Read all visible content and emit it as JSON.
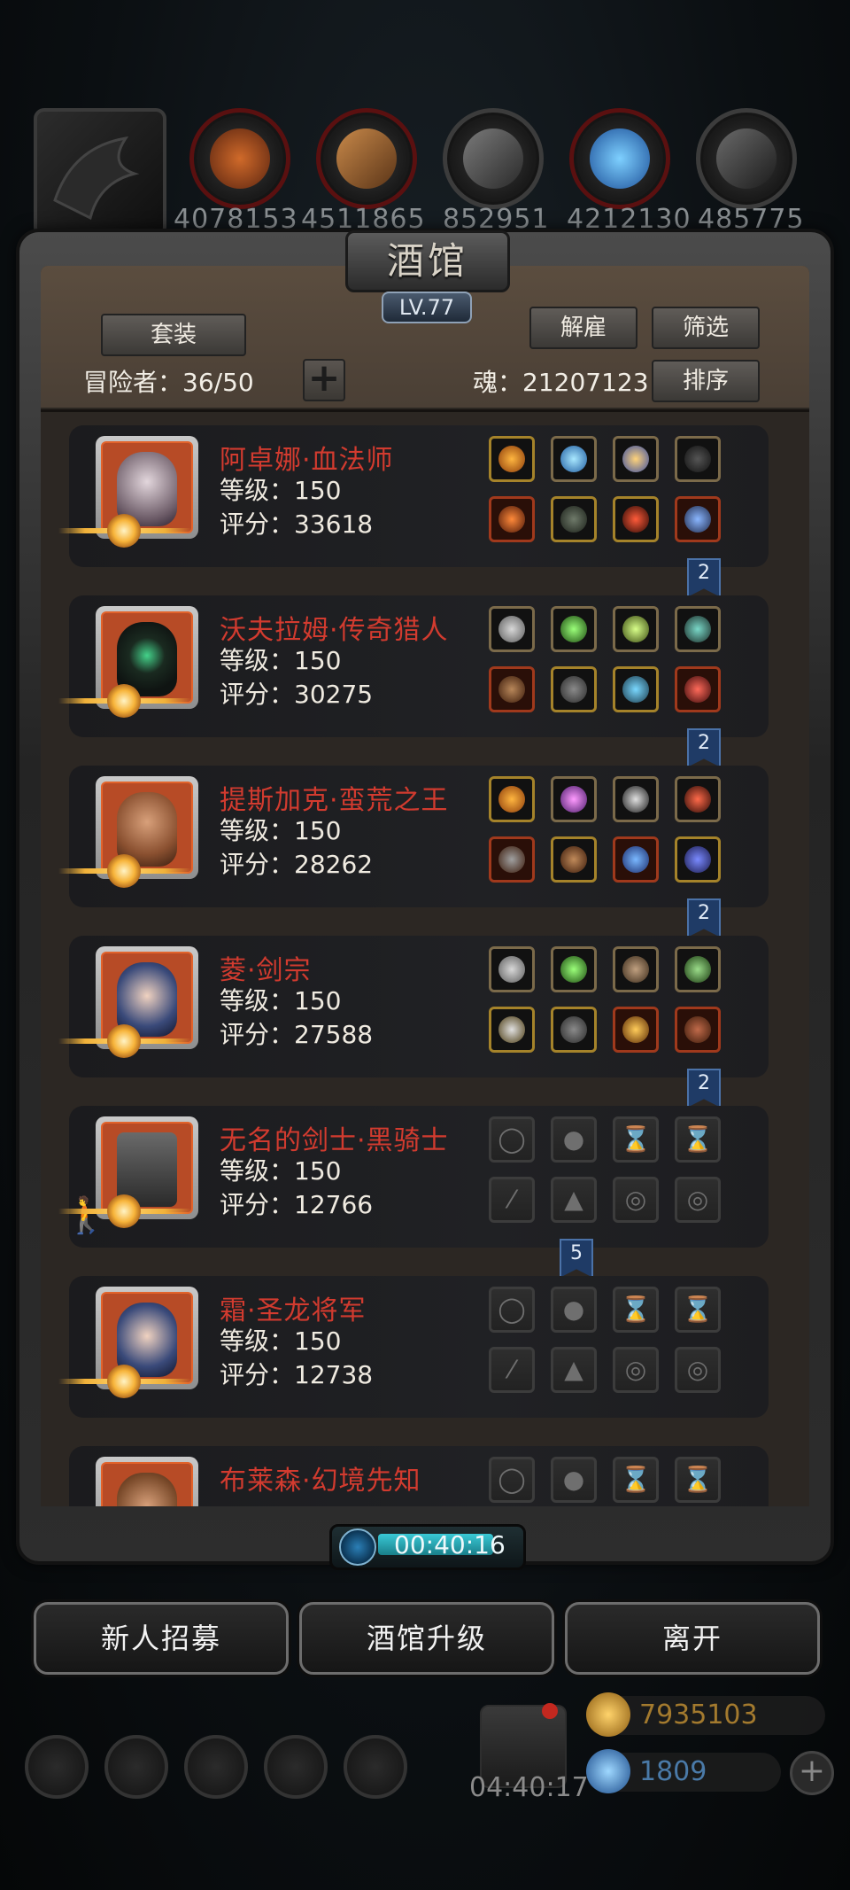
{
  "top_bar": {
    "resources": [
      {
        "icon": "ore-icon",
        "value": "4078153"
      },
      {
        "icon": "wood-icon",
        "value": "4511865"
      },
      {
        "icon": "stone-icon",
        "value": "852951"
      },
      {
        "icon": "crystal-icon",
        "value": "4212130"
      },
      {
        "icon": "iron-icon",
        "value": "485775"
      }
    ]
  },
  "header": {
    "title": "酒馆",
    "level": "LV.77",
    "set_button": "套装",
    "dismiss_button": "解雇",
    "filter_button": "筛选",
    "sort_button": "排序",
    "adventurer_label": "冒险者：36/50",
    "soul_label": "魂：21207123",
    "add_icon": "plus-icon"
  },
  "heroes": [
    {
      "name": "阿卓娜·血法师",
      "level": "等级：150",
      "score": "评分：33618",
      "ribbon": "2",
      "empty": false
    },
    {
      "name": "沃夫拉姆·传奇猎人",
      "level": "等级：150",
      "score": "评分：30275",
      "ribbon": "2",
      "empty": false
    },
    {
      "name": "提斯加克·蛮荒之王",
      "level": "等级：150",
      "score": "评分：28262",
      "ribbon": "2",
      "empty": false
    },
    {
      "name": "菱·剑宗",
      "level": "等级：150",
      "score": "评分：27588",
      "ribbon": "2",
      "empty": false
    },
    {
      "name": "无名的剑士·黑骑士",
      "level": "等级：150",
      "score": "评分：12766",
      "ribbon": "5",
      "empty": true
    },
    {
      "name": "霜·圣龙将军",
      "level": "等级：150",
      "score": "评分：12738",
      "ribbon": "",
      "empty": true
    },
    {
      "name": "布莱森·幻境先知",
      "level": "",
      "score": "",
      "ribbon": "",
      "empty": true
    }
  ],
  "timer": {
    "value": "00:40:16"
  },
  "actions": {
    "recruit": "新人招募",
    "upgrade": "酒馆升级",
    "leave": "离开"
  },
  "footer": {
    "gift_timer": "04:40:17",
    "gold": "7935103",
    "gems": "1809"
  },
  "colors": {
    "hero_name": "#d23b2f",
    "accent_blue": "#1f3b66",
    "panel": "#2c2723"
  }
}
